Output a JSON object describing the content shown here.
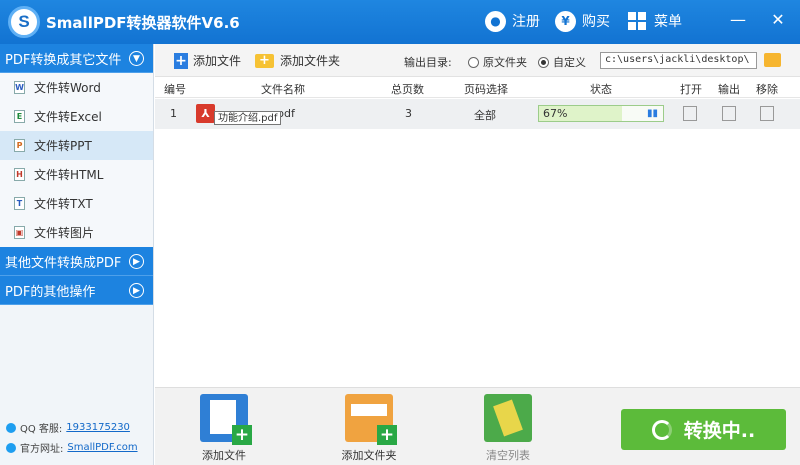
{
  "app": {
    "title": "SmallPDF转换器软件V6.6",
    "logo_letter": "S"
  },
  "titlebar": {
    "register": "注册",
    "register_icon": "user-icon",
    "buy": "购买",
    "buy_icon": "yen-icon",
    "menu": "菜单",
    "menu_icon": "grid-icon"
  },
  "sidebar": {
    "categories": [
      {
        "label": "PDF转换成其它文件",
        "expanded": true
      },
      {
        "label": "其他文件转换成PDF",
        "expanded": false
      },
      {
        "label": "PDF的其他操作",
        "expanded": false
      }
    ],
    "items": [
      {
        "label": "文件转Word",
        "icon": "W"
      },
      {
        "label": "文件转Excel",
        "icon": "E"
      },
      {
        "label": "文件转PPT",
        "icon": "P",
        "active": true
      },
      {
        "label": "文件转HTML",
        "icon": "H"
      },
      {
        "label": "文件转TXT",
        "icon": "T"
      },
      {
        "label": "文件转图片",
        "icon": "▣"
      }
    ],
    "qq_label": "QQ 客服:",
    "qq_value": "1933175230",
    "site_label": "官方网址:",
    "site_value": "SmallPDF.com"
  },
  "toolbar": {
    "add_file": "添加文件",
    "add_folder": "添加文件夹",
    "output_label": "输出目录:",
    "radio_original": "原文件夹",
    "radio_custom": "自定义",
    "selected": "custom",
    "path": "c:\\users\\jackli\\desktop\\"
  },
  "table": {
    "headers": [
      "编号",
      "文件名称",
      "总页数",
      "页码选择",
      "状态",
      "打开",
      "输出",
      "移除"
    ],
    "rows": [
      {
        "index": "1",
        "filename_visible": "pdf",
        "tooltip": "功能介绍.pdf",
        "pages": "3",
        "range": "全部",
        "progress_text": "67%",
        "progress": 0.67
      }
    ]
  },
  "bottom": {
    "add_file": "添加文件",
    "add_folder": "添加文件夹",
    "clear_list": "清空列表",
    "convert": "转换中.."
  },
  "colors": {
    "brand_blue": "#1273d2",
    "accent_green": "#5cbb3a",
    "pdf_red": "#d83a2c"
  }
}
